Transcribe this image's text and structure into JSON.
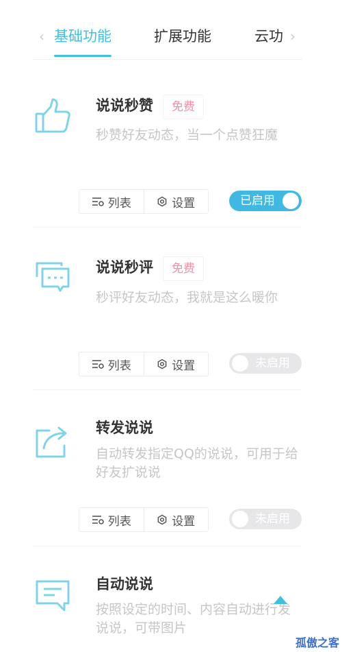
{
  "tabs": {
    "items": [
      "基础功能",
      "扩展功能",
      "云功"
    ],
    "active_index": 0
  },
  "features": [
    {
      "title": "说说秒赞",
      "badge": "免费",
      "description": "秒赞好友动态，当一个点赞狂魔",
      "list_label": "列表",
      "settings_label": "设置",
      "toggle_label": "已启用",
      "enabled": true
    },
    {
      "title": "说说秒评",
      "badge": "免费",
      "description": "秒评好友动态，我就是这么暖你",
      "list_label": "列表",
      "settings_label": "设置",
      "toggle_label": "未启用",
      "enabled": false
    },
    {
      "title": "转发说说",
      "badge": "",
      "description": "自动转发指定QQ的说说，可用于给好友扩说说",
      "list_label": "列表",
      "settings_label": "设置",
      "toggle_label": "未启用",
      "enabled": false
    },
    {
      "title": "自动说说",
      "badge": "",
      "description": "按照设定的时间、内容自动进行发说说，可带图片"
    }
  ],
  "watermark": "孤傲之客",
  "colors": {
    "accent": "#3fc1dd",
    "toggle_on": "#3fb9e1",
    "badge": "#f08fa6",
    "icon": "#7fd3e8"
  },
  "icons": [
    "thumbs-up-icon",
    "chat-bubbles-icon",
    "share-icon",
    "message-icon",
    "list-icon",
    "settings-icon",
    "arrow-up-icon"
  ]
}
